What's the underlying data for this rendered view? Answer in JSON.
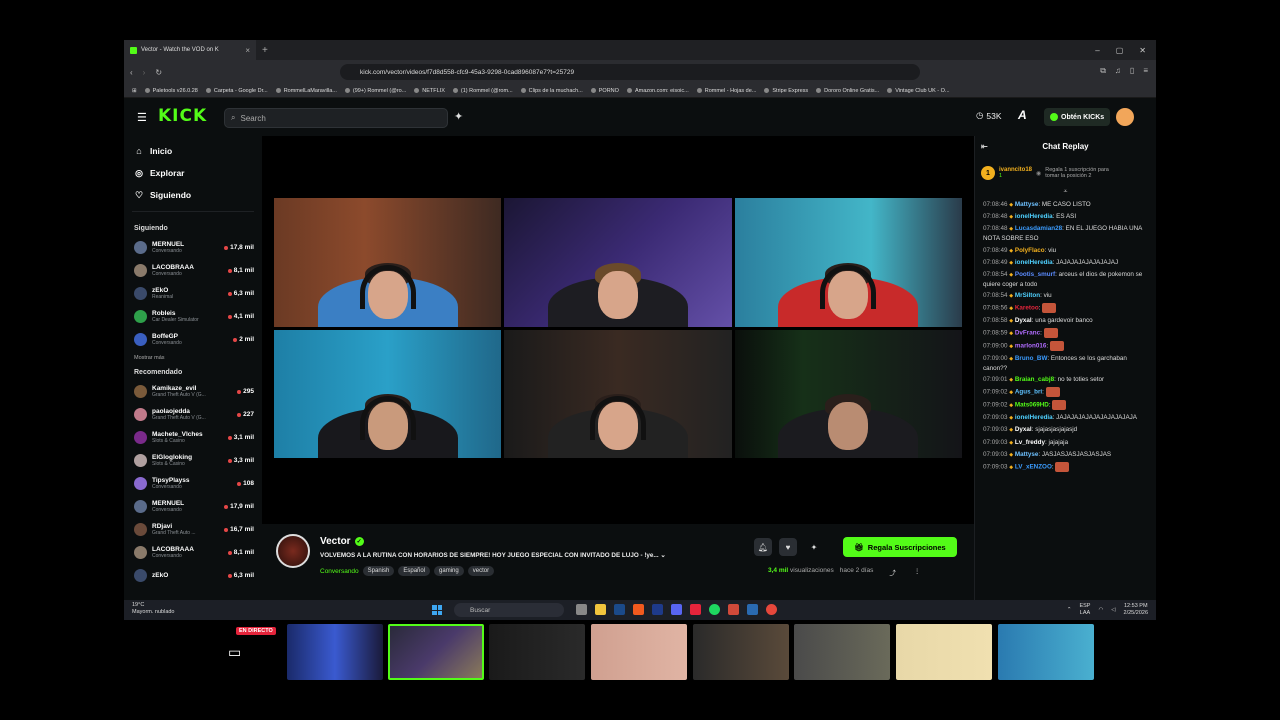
{
  "browser": {
    "tab_title": "Vector - Watch the VOD on K",
    "url": "kick.com/vector/videos/f7d8d558-cfc9-45a3-9298-0cad896087e7?t=25729",
    "bookmarks": [
      "Paletools v26.0.28",
      "Carpeta - Google Dr...",
      "RommelLaMaravilla...",
      "(99+) Rommel (@ro...",
      "NETFLIX",
      "(1) Rommel (@rom...",
      "Clips de la muchach...",
      "PORNO",
      "Amazon.com: eisoic...",
      "Rommel - Hojas de...",
      "Stripe Express",
      "Dororo Online Gratis...",
      "Vintage Club UK - O..."
    ]
  },
  "header": {
    "logo": "KICK",
    "search_placeholder": "Search",
    "viewers": "53K",
    "get_kicks": "Obtén KICKs"
  },
  "sidebar": {
    "nav": [
      {
        "label": "Inicio",
        "icon": "home-icon"
      },
      {
        "label": "Explorar",
        "icon": "compass-icon"
      },
      {
        "label": "Siguiendo",
        "icon": "heart-icon"
      }
    ],
    "following_title": "Siguiendo",
    "following": [
      {
        "name": "MERNUEL",
        "category": "Conversando",
        "viewers": "17,8 mil",
        "color": "#5a6b8a"
      },
      {
        "name": "LACOBRAAA",
        "category": "Conversando",
        "viewers": "8,1 mil",
        "color": "#8a7a6a"
      },
      {
        "name": "zEkO",
        "category": "Reanimal",
        "viewers": "6,3 mil",
        "color": "#3a4a6a"
      },
      {
        "name": "Robleis",
        "category": "Car Dealer Simulator",
        "viewers": "4,1 mil",
        "color": "#2ea04a"
      },
      {
        "name": "BoffeGP",
        "category": "Conversando",
        "viewers": "2 mil",
        "color": "#3a5fc0"
      }
    ],
    "show_more": "Mostrar más",
    "recommended_title": "Recomendado",
    "recommended": [
      {
        "name": "Kamikaze_evil",
        "category": "Grand Theft Auto V (G...",
        "viewers": "295",
        "color": "#7a5a3a"
      },
      {
        "name": "paolaojedda",
        "category": "Grand Theft Auto V (G...",
        "viewers": "227",
        "color": "#c07a8a"
      },
      {
        "name": "Machete_Vlches",
        "category": "Slots & Casino",
        "viewers": "3,1 mil",
        "color": "#7a2a8a"
      },
      {
        "name": "ElGlogloking",
        "category": "Slots & Casino",
        "viewers": "3,3 mil",
        "color": "#b0a0a0"
      },
      {
        "name": "TipsyPlayss",
        "category": "Conversando",
        "viewers": "108",
        "color": "#8a6ad0"
      },
      {
        "name": "MERNUEL",
        "category": "Conversando",
        "viewers": "17,9 mil",
        "color": "#5a6b8a"
      },
      {
        "name": "RDjavi",
        "category": "Grand Theft Auto ...",
        "viewers": "16,7 mil",
        "color": "#6a4a3a"
      },
      {
        "name": "LACOBRAAA",
        "category": "Conversando",
        "viewers": "8,1 mil",
        "color": "#8a7a6a"
      },
      {
        "name": "zEkO",
        "category": "",
        "viewers": "6,3 mil",
        "color": "#3a4a6a"
      }
    ]
  },
  "stream": {
    "streamer": "Vector",
    "title": "VOLVEMOS A LA RUTINA CON HORARIOS DE SIEMPRE! HOY JUEGO ESPECIAL CON INVITADO DE LUJO - !ye...",
    "category": "Conversando",
    "tags": [
      "Spanish",
      "Español",
      "gaming",
      "vector"
    ],
    "subscribe_label": "Regala Suscripciones",
    "views": "3,4 mil",
    "views_suffix": "visualizaciones",
    "ago": "hace 2 días"
  },
  "chat": {
    "title": "Chat Replay",
    "pinned_user": "ivanncito18",
    "pinned_count": "1",
    "pinned_text": "Regala 1 suscripción para tomar la posición 2",
    "messages": [
      {
        "ts": "07:08:46",
        "user": "Mattyse",
        "color": "#6ec1ff",
        "text": "ME CASO LISTO"
      },
      {
        "ts": "07:08:48",
        "user": "ionelHeredia",
        "color": "#4fd1ff",
        "text": "ES ASI"
      },
      {
        "ts": "07:08:48",
        "user": "Lucasdamian28",
        "color": "#3b9cff",
        "text": "EN EL JUEGO HABIA UNA NOTA SOBRE ESO"
      },
      {
        "ts": "07:08:49",
        "user": "PolyFlaco",
        "color": "#f2b01e",
        "text": "viu"
      },
      {
        "ts": "07:08:49",
        "user": "ionelHeredia",
        "color": "#4fd1ff",
        "text": "JAJAJAJAJAJAJAJAJ"
      },
      {
        "ts": "07:08:54",
        "user": "Pootis_smurf",
        "color": "#5b8cff",
        "text": "arceus el dios de pokemon se quiere coger a todo"
      },
      {
        "ts": "07:08:54",
        "user": "MrSilton",
        "color": "#4fd1ff",
        "text": "viu"
      },
      {
        "ts": "07:08:56",
        "user": "Karetoo",
        "color": "#e5243b",
        "text": ""
      },
      {
        "ts": "07:08:58",
        "user": "Dyxal",
        "color": "#ffffff",
        "text": "una gardevoir banco"
      },
      {
        "ts": "07:08:59",
        "user": "DvFranc",
        "color": "#b06cff",
        "text": ""
      },
      {
        "ts": "07:09:00",
        "user": "marlon016",
        "color": "#b06cff",
        "text": ""
      },
      {
        "ts": "07:09:00",
        "user": "Bruno_BW",
        "color": "#3b9cff",
        "text": "Entonces se los garchaban canon??"
      },
      {
        "ts": "07:09:01",
        "user": "Braian_cabj8",
        "color": "#53fc18",
        "text": "no te toties setor"
      },
      {
        "ts": "07:09:02",
        "user": "Agus_bri",
        "color": "#5ec2ff",
        "text": ""
      },
      {
        "ts": "07:09:02",
        "user": "Mats069HD",
        "color": "#53fc18",
        "text": ""
      },
      {
        "ts": "07:09:03",
        "user": "ionelHeredia",
        "color": "#4fd1ff",
        "text": "JAJAJAJAJAJAJAJAJAJAJA"
      },
      {
        "ts": "07:09:03",
        "user": "Dyxal",
        "color": "#ffffff",
        "text": "sjajasjasjajasjd"
      },
      {
        "ts": "07:09:03",
        "user": "Lv_freddy",
        "color": "#ffffff",
        "text": "jajajaja"
      },
      {
        "ts": "07:09:03",
        "user": "Mattyse",
        "color": "#6ec1ff",
        "text": "JASJASJASJASJASJAS"
      },
      {
        "ts": "07:09:03",
        "user": "LV_xENZOO",
        "color": "#3b9cff",
        "text": ""
      }
    ]
  },
  "taskbar": {
    "weather_temp": "19°C",
    "weather_desc": "Mayorm. nublado",
    "search": "Buscar",
    "lang": "ESP",
    "region": "LAA",
    "time": "12:53 PM",
    "date": "2/25/2026"
  },
  "bottom": {
    "live_badge": "EN DIRECTO"
  }
}
